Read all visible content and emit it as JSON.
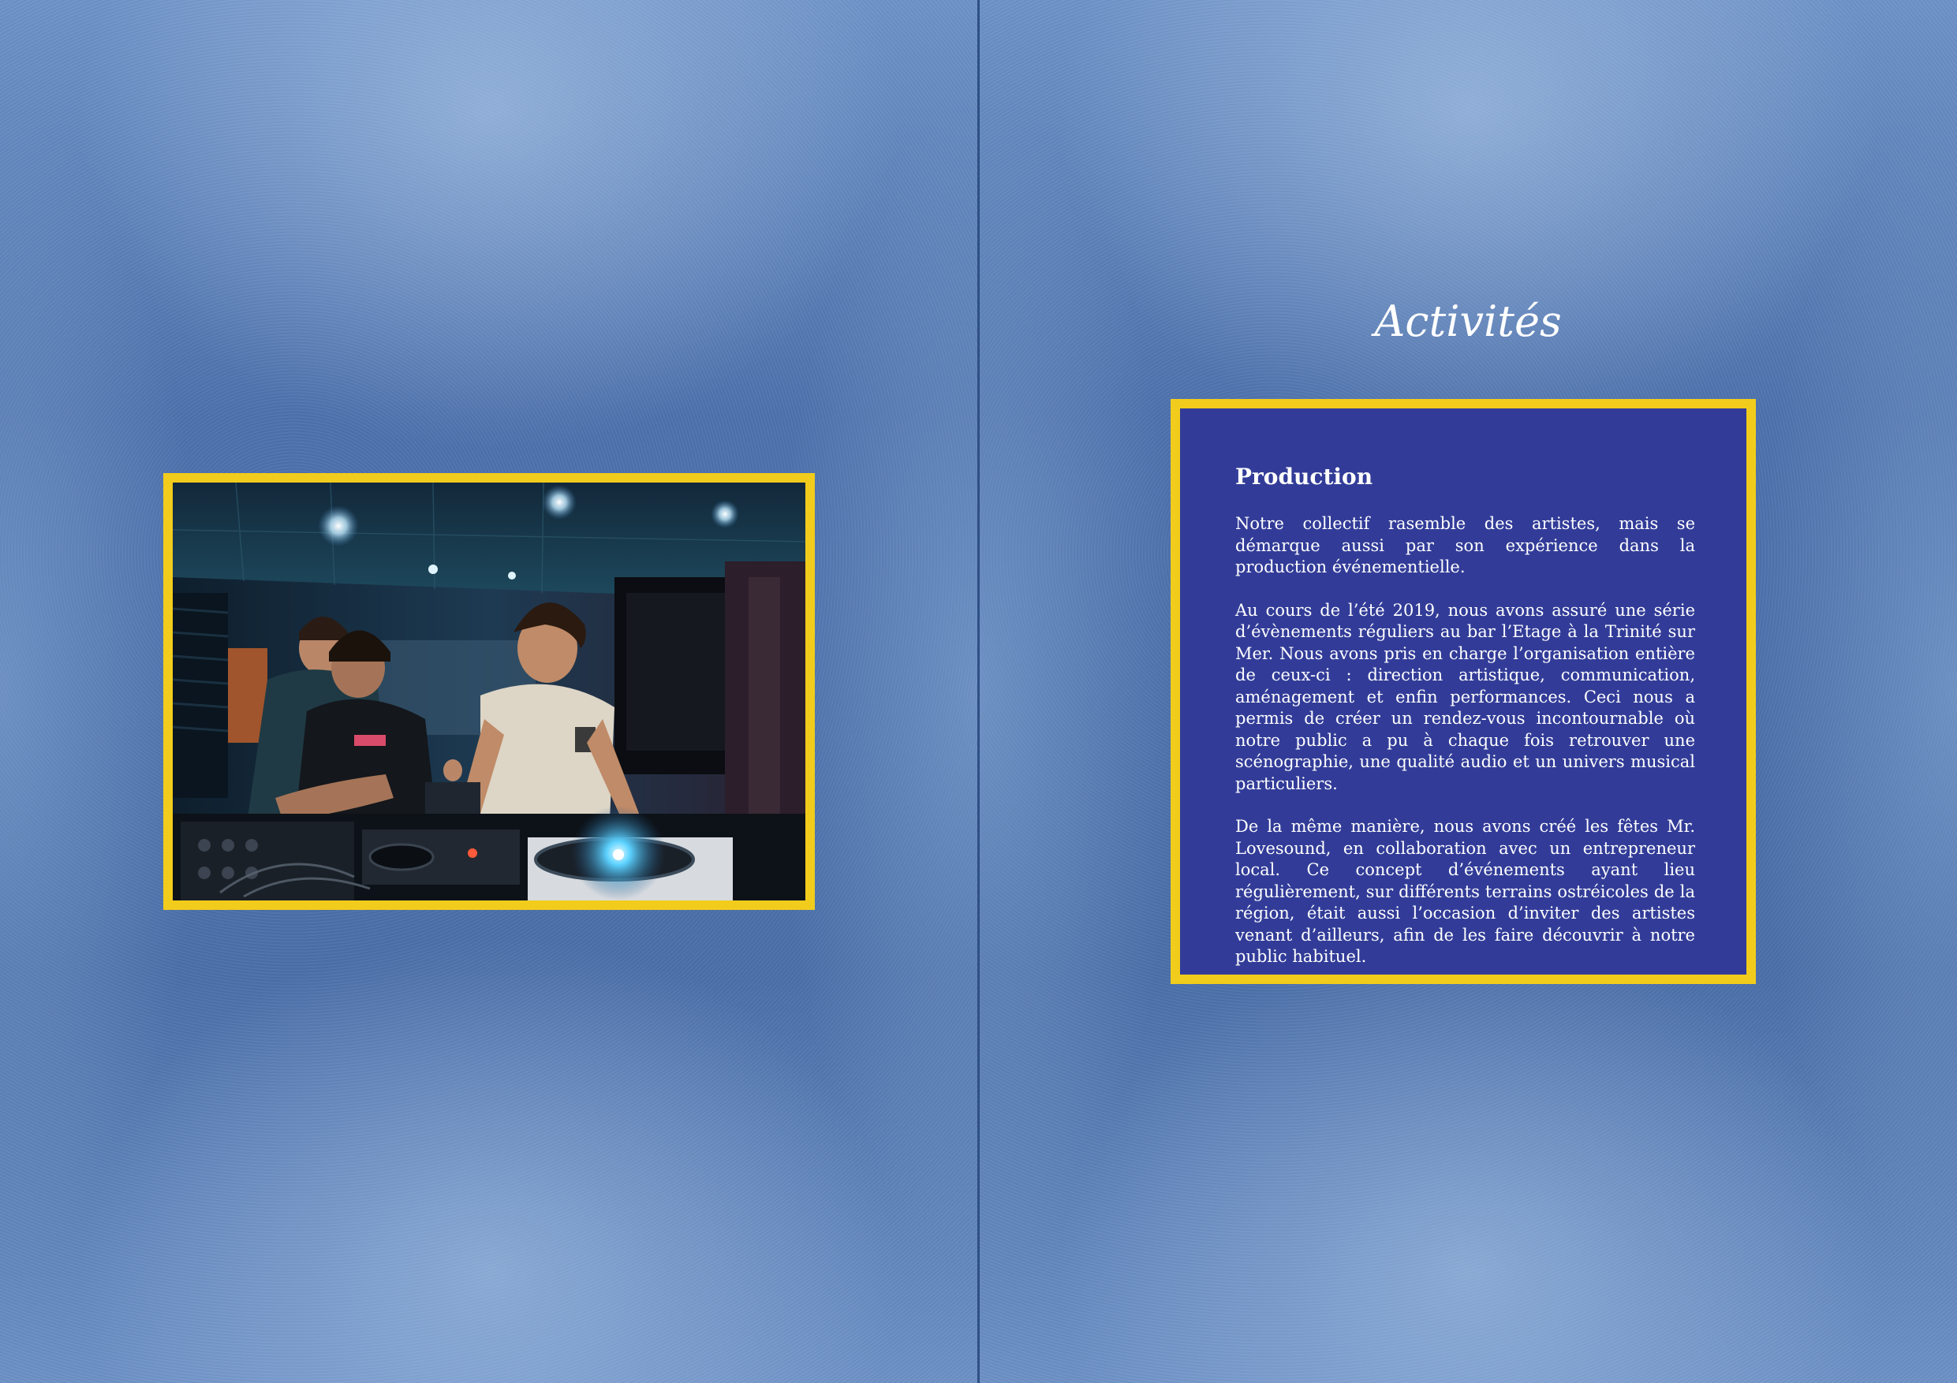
{
  "left_page": {
    "photo": {
      "subject": "DJs performing at turntables in a bar",
      "frame_color": "#f2cc1c"
    }
  },
  "right_page": {
    "title": "Activités",
    "box": {
      "heading": "Production",
      "paragraphs": [
        "Notre collectif rasemble des artistes, mais se démarque aussi par son expérience dans la production événementielle.",
        "Au cours de l’été 2019, nous avons assuré une série d’évènements réguliers au bar l’Etage à la Trinité sur Mer. Nous avons pris en charge l’organisation entière de ceux-ci : direction artistique, communication, aménagement et enfin performances. Ceci nous a permis de créer un rendez-vous incontournable où notre public a pu à chaque fois retrouver une scénographie, une qualité audio et un univers musical particuliers.",
        "De la même manière,  nous avons créé les fêtes Mr. Lovesound, en collaboration avec un entrepreneur local. Ce concept d’événements ayant lieu régulièrement, sur différents terrains ostréicoles de la région, était aussi l’occasion d’inviter des artistes venant d’ailleurs, afin de les faire découvrir à notre public habituel."
      ],
      "background_color": "#323c98",
      "border_color": "#f2cc1c"
    }
  }
}
